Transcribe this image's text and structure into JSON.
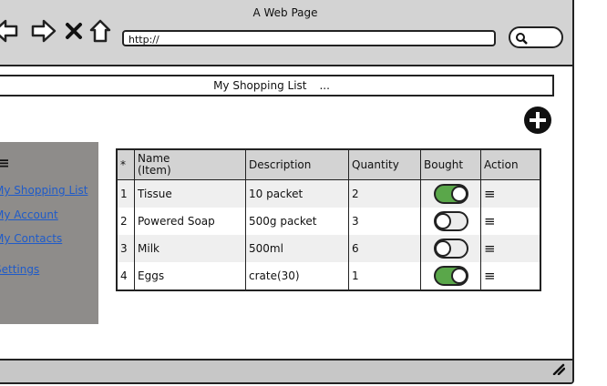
{
  "window": {
    "title": "A Web Page"
  },
  "nav": {
    "back_icon": "arrow-left-icon",
    "forward_icon": "arrow-right-icon",
    "stop_icon": "close-icon",
    "home_icon": "home-icon",
    "url": "http://",
    "search_icon": "search-icon"
  },
  "tab": {
    "label": "My Shopping List",
    "suffix": "..."
  },
  "sidebar": {
    "menu_icon": "hamburger-icon",
    "items": [
      {
        "label": "My Shopping List"
      },
      {
        "label": "My Account"
      },
      {
        "label": "My Contacts"
      },
      {
        "label": "Settings"
      }
    ]
  },
  "table": {
    "headers": {
      "index": "*",
      "name_line1": "Name",
      "name_line2": "(Item)",
      "description": "Description",
      "quantity": "Quantity",
      "bought": "Bought",
      "action": "Action"
    },
    "rows": [
      {
        "index": "1",
        "name": "Tissue",
        "description": "10 packet",
        "quantity": "2",
        "bought": true
      },
      {
        "index": "2",
        "name": "Powered Soap",
        "description": "500g packet",
        "quantity": "3",
        "bought": false
      },
      {
        "index": "3",
        "name": "Milk",
        "description": "500ml",
        "quantity": "6",
        "bought": false
      },
      {
        "index": "4",
        "name": "Eggs",
        "description": "crate(30)",
        "quantity": "1",
        "bought": true
      }
    ]
  },
  "colors": {
    "toggle_on": "#5aa74a",
    "sidebar_bg": "#8e8c8a",
    "link": "#1f5bc9"
  }
}
